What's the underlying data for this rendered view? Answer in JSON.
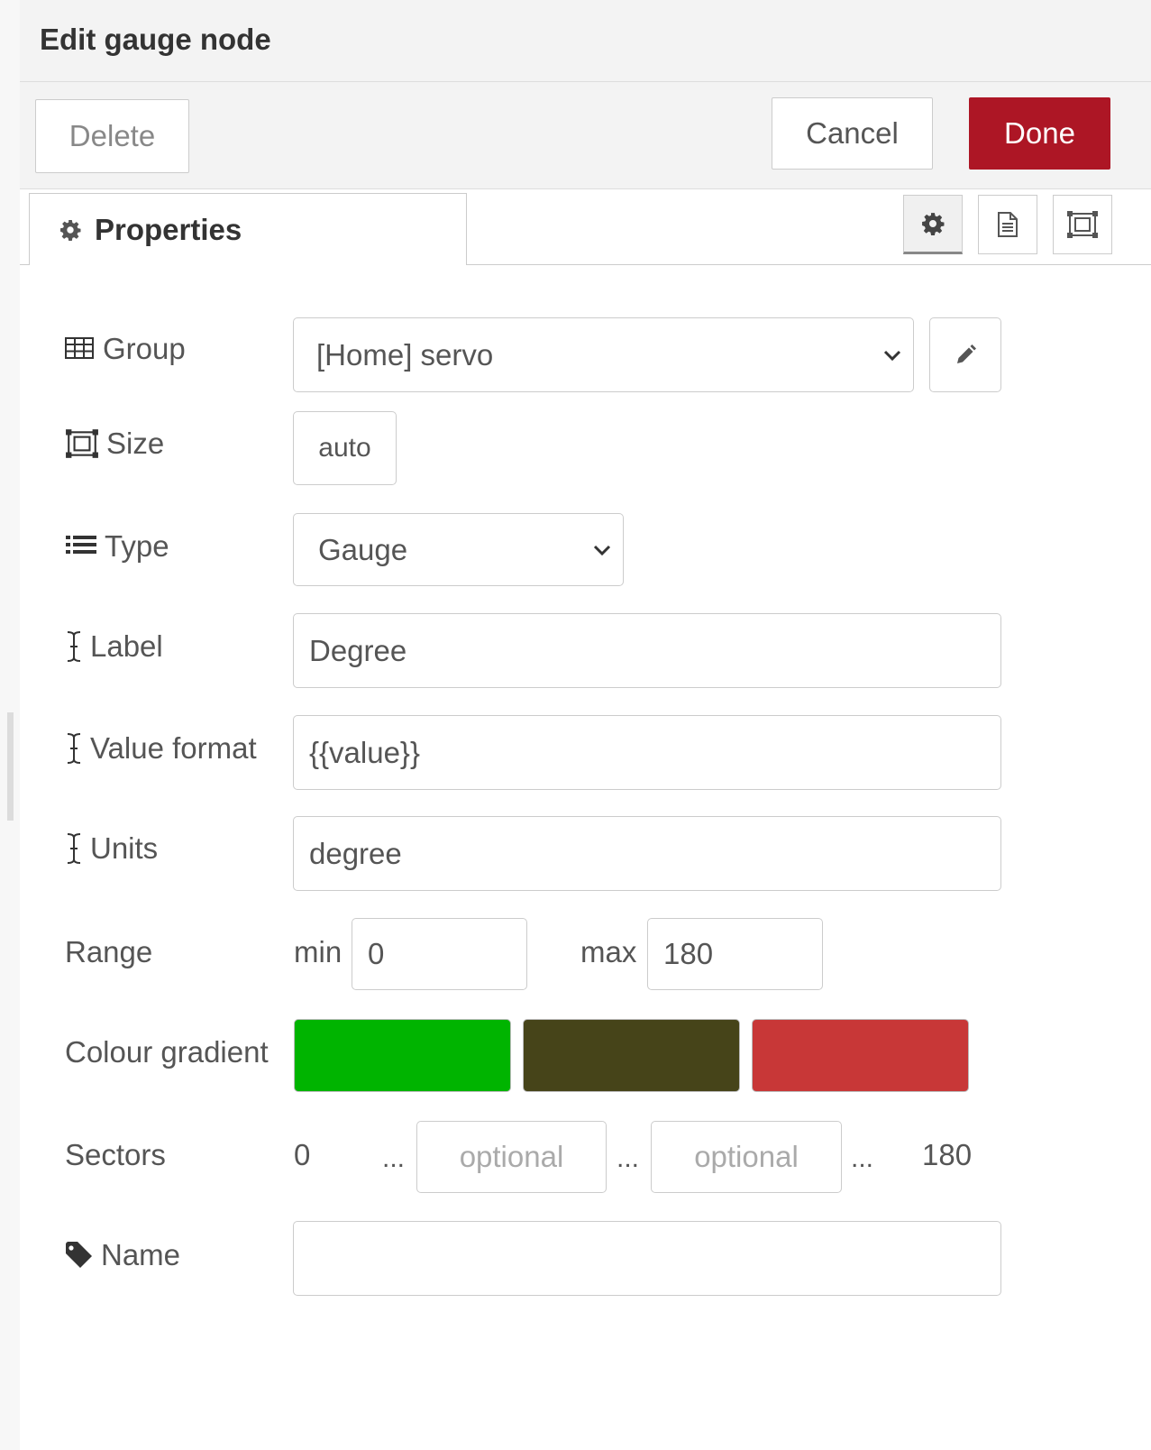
{
  "dialog": {
    "title": "Edit gauge node"
  },
  "toolbar": {
    "delete_label": "Delete",
    "cancel_label": "Cancel",
    "done_label": "Done"
  },
  "tabs": {
    "properties_label": "Properties",
    "icons": [
      "gear-icon",
      "description-icon",
      "appearance-icon"
    ]
  },
  "form": {
    "group": {
      "label": "Group",
      "icon": "table-icon",
      "value": "[Home] servo"
    },
    "size": {
      "label": "Size",
      "icon": "size-icon",
      "value": "auto"
    },
    "type": {
      "label": "Type",
      "icon": "list-icon",
      "value": "Gauge"
    },
    "label": {
      "label": "Label",
      "icon": "text-cursor-icon",
      "value": "Degree"
    },
    "value_format": {
      "label": "Value format",
      "icon": "text-cursor-icon",
      "value": "{{value}}"
    },
    "units": {
      "label": "Units",
      "icon": "text-cursor-icon",
      "value": "degree"
    },
    "range": {
      "label": "Range",
      "min_label": "min",
      "min_value": "0",
      "max_label": "max",
      "max_value": "180"
    },
    "colour_gradient": {
      "label": "Colour gradient",
      "colors": [
        "#00b400",
        "#464419",
        "#c83737"
      ]
    },
    "sectors": {
      "label": "Sectors",
      "start": "0",
      "ellipsis": "...",
      "placeholder_1": "optional",
      "placeholder_2": "optional",
      "end": "180"
    },
    "name": {
      "label": "Name",
      "icon": "tag-icon",
      "value": ""
    }
  },
  "colors": {
    "done_button": "#ad1625",
    "header_bg": "#f3f3f3"
  }
}
